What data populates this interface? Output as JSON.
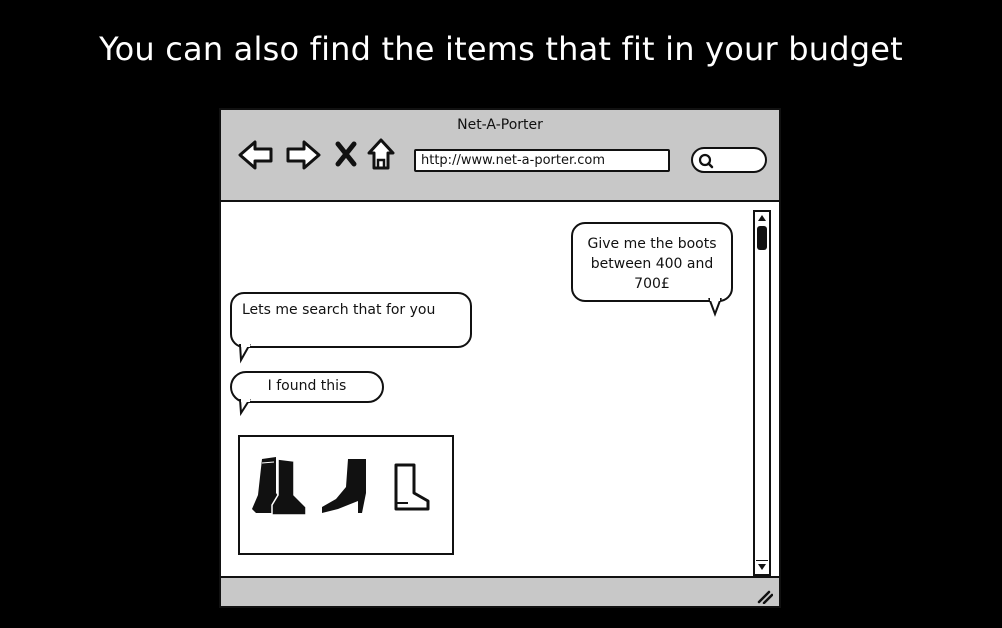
{
  "slide": {
    "title": "You can also find the items that fit in your budget"
  },
  "browser": {
    "window_title": "Net-A-Porter",
    "url": "http://www.net-a-porter.com",
    "nav_icons": [
      "back-arrow-icon",
      "forward-arrow-icon",
      "stop-icon",
      "home-icon"
    ],
    "search_icon": "search-icon"
  },
  "chat": {
    "user_message": "Give me the boots between 400 and 700£",
    "bot_message_1": "Lets me search that for you",
    "bot_message_2": "I found this"
  },
  "results": {
    "items": [
      "ankle-boots-pair",
      "high-heel-boot",
      "rain-boot"
    ]
  },
  "colors": {
    "background": "#000000",
    "chrome": "#c8c8c8",
    "ink": "#111111"
  }
}
